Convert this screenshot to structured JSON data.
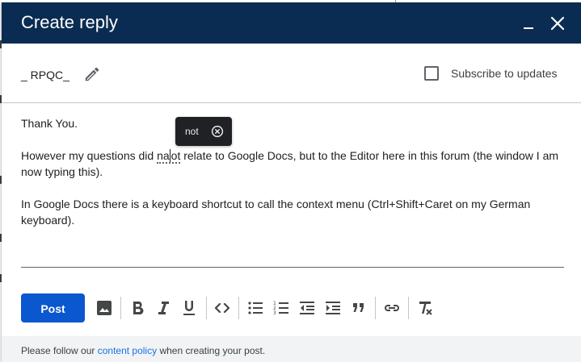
{
  "dialog": {
    "title": "Create reply",
    "minimize_label": "minimize-icon",
    "close_label": "close-icon"
  },
  "meta": {
    "username": "_ RPQC_",
    "edit_icon": "pencil-icon",
    "subscribe_label": "Subscribe to updates",
    "subscribe_checked": false
  },
  "editor": {
    "line1": "Thank You.",
    "line2_before": "However my questions did ",
    "line2_word_a": "na",
    "line2_word_b": "ot",
    "line2_after": " relate to Google Docs, but to the Editor here in this forum (the window I am now typing this).",
    "line3": "In Google Docs there is a keyboard shortcut to call the context menu (Ctrl+Shift+Caret on my German keyboard)."
  },
  "spellcheck": {
    "suggestion": "not",
    "dismiss_icon": "circle-x-icon"
  },
  "toolbar": {
    "post_label": "Post",
    "buttons": [
      "image-icon",
      "bold-icon",
      "italic-icon",
      "underline-icon",
      "code-icon",
      "bulleted-list-icon",
      "numbered-list-icon",
      "decrease-indent-icon",
      "increase-indent-icon",
      "quote-icon",
      "link-icon",
      "clear-formatting-icon"
    ]
  },
  "footer": {
    "prefix": "Please follow our ",
    "link": "content policy",
    "suffix": " when creating your post."
  },
  "colors": {
    "header_bg": "#0b2c52",
    "post_button": "#0b57d0",
    "link": "#1a73e8",
    "footer_bg": "#f1f3f4"
  }
}
